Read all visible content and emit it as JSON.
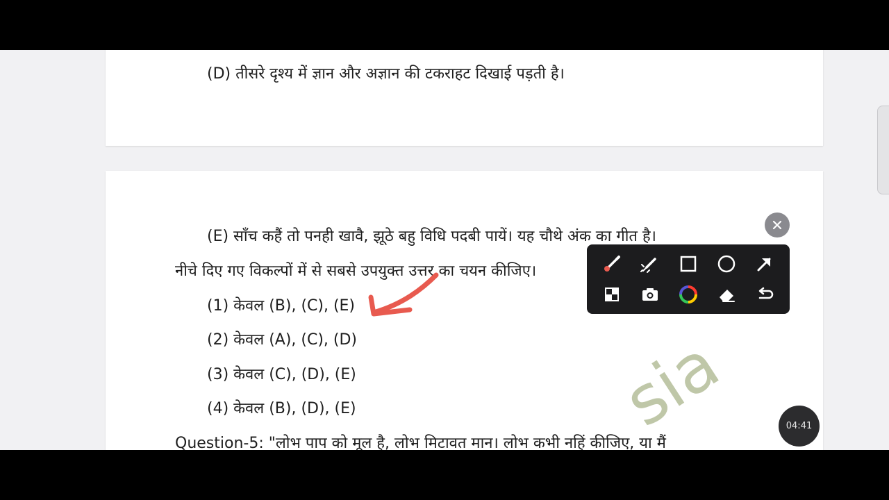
{
  "doc": {
    "line_d": "(D) तीसरे दृश्य में ज्ञान और अज्ञान की टकराहट दिखाई पड़ती है।",
    "line_e": "(E) साँच कहैं तो पनही खावै, झूठे बहु विधि पदबी पायें। यह चौथे अंक का गीत है।",
    "instruction": "नीचे दिए गए विकल्पों में से सबसे उपयुक्त उत्तर का चयन कीजिए।",
    "options": [
      "(1) केवल (B), (C), (E)",
      "(2) केवल (A), (C), (D)",
      "(3) केवल (C), (D), (E)",
      "(4) केवल (B), (D), (E)"
    ],
    "next_question": "Question-5: \"लोभ पाप को मूल है, लोभ मिटावत मान। लोभ कभी नहिं कीजिए, या मैं"
  },
  "watermark": "sia",
  "annotation_toolbar": {
    "tools": [
      "pen-icon",
      "highlighter-icon",
      "rectangle-icon",
      "circle-icon",
      "arrow-icon",
      "mosaic-icon",
      "camera-icon",
      "color-wheel-icon",
      "eraser-icon",
      "undo-icon"
    ],
    "pen_color": "#e85a4f"
  },
  "timer": "04:41"
}
